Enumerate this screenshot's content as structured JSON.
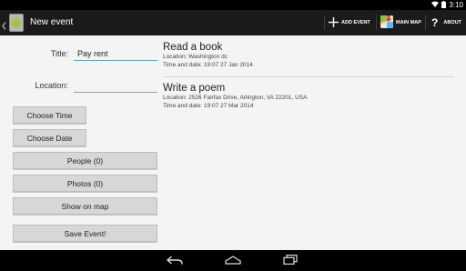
{
  "status_bar": {
    "time": "3:10"
  },
  "action_bar": {
    "title": "New event",
    "add_event_label": "ADD EVENT",
    "main_map_label": "MAIN MAP",
    "about_label": "ABOUT"
  },
  "form": {
    "title_label": "Title:",
    "title_value": "Pay rent",
    "location_label": "Location:",
    "location_value": ""
  },
  "buttons": {
    "choose_time": "Choose Time",
    "choose_date": "Choose Date",
    "people": "People (0)",
    "photos": "Photos (0)",
    "show_on_map": "Show on map",
    "save_event": "Save Event!"
  },
  "events": [
    {
      "title": "Read a book",
      "location": "Location: Washington dc",
      "time_and_date": "Time and date:   19:07   27 Jan 2014"
    },
    {
      "title": "Write a poem",
      "location": "Location: 2526 Fairfax Drive, Arlington, VA 22201, USA",
      "time_and_date": "Time and date:   19:07   27 Mar 2014"
    }
  ],
  "colors": {
    "accent": "#33b5e5",
    "action_bar": "#1b1b1b",
    "background": "#f4f4f4"
  },
  "icons": [
    "wifi-icon",
    "battery-icon",
    "android-app-icon",
    "add-icon",
    "map-icon",
    "help-icon",
    "back-icon",
    "home-icon",
    "recents-icon"
  ]
}
